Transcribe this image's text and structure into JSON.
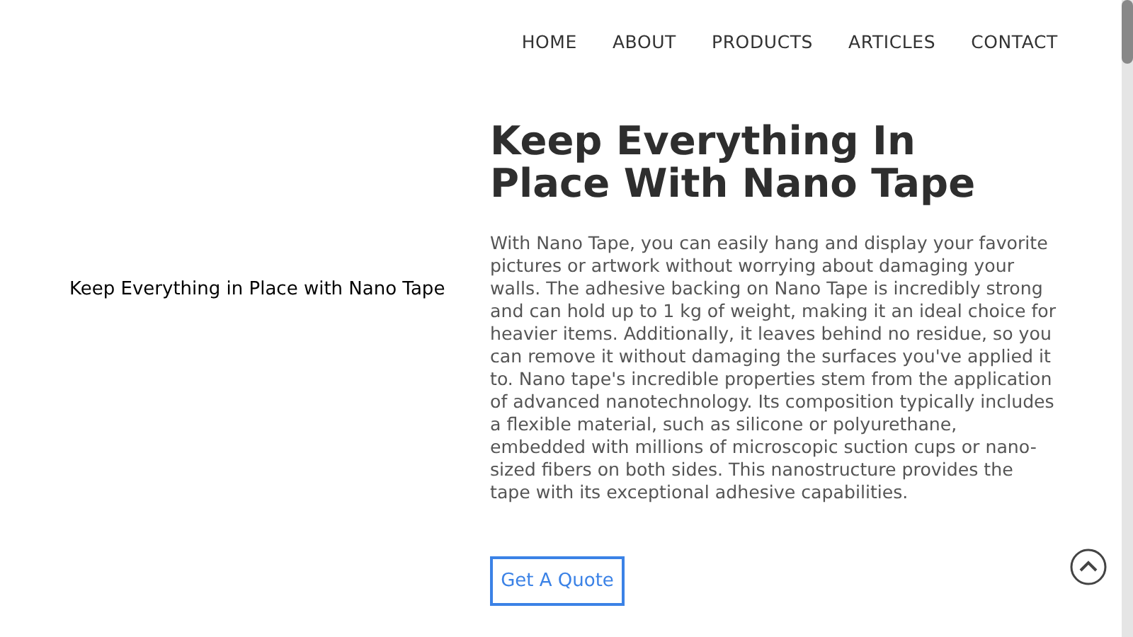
{
  "nav": {
    "links": [
      {
        "label": "HOME"
      },
      {
        "label": "ABOUT"
      },
      {
        "label": "PRODUCTS"
      },
      {
        "label": "ARTICLES"
      },
      {
        "label": "CONTACT"
      }
    ]
  },
  "image_alt": "Keep Everything in Place with Nano Tape",
  "hero": {
    "title": "Keep Everything In Place With Nano Tape",
    "body": "With Nano Tape, you can easily hang and display your favorite pictures or artwork without worrying about damaging your walls. The adhesive backing on Nano Tape is incredibly strong and can hold up to 1 kg of weight, making it an ideal choice for heavier items. Additionally, it leaves behind no residue, so you can remove it without damaging the surfaces you've applied it to. Nano tape's incredible properties stem from the application of advanced nanotechnology. Its composition typically includes a flexible material, such as silicone or polyurethane, embedded with millions of microscopic suction cups or nano-sized fibers on both sides. This nanostructure provides the tape with its exceptional adhesive capabilities.",
    "button": "Get A Quote"
  }
}
